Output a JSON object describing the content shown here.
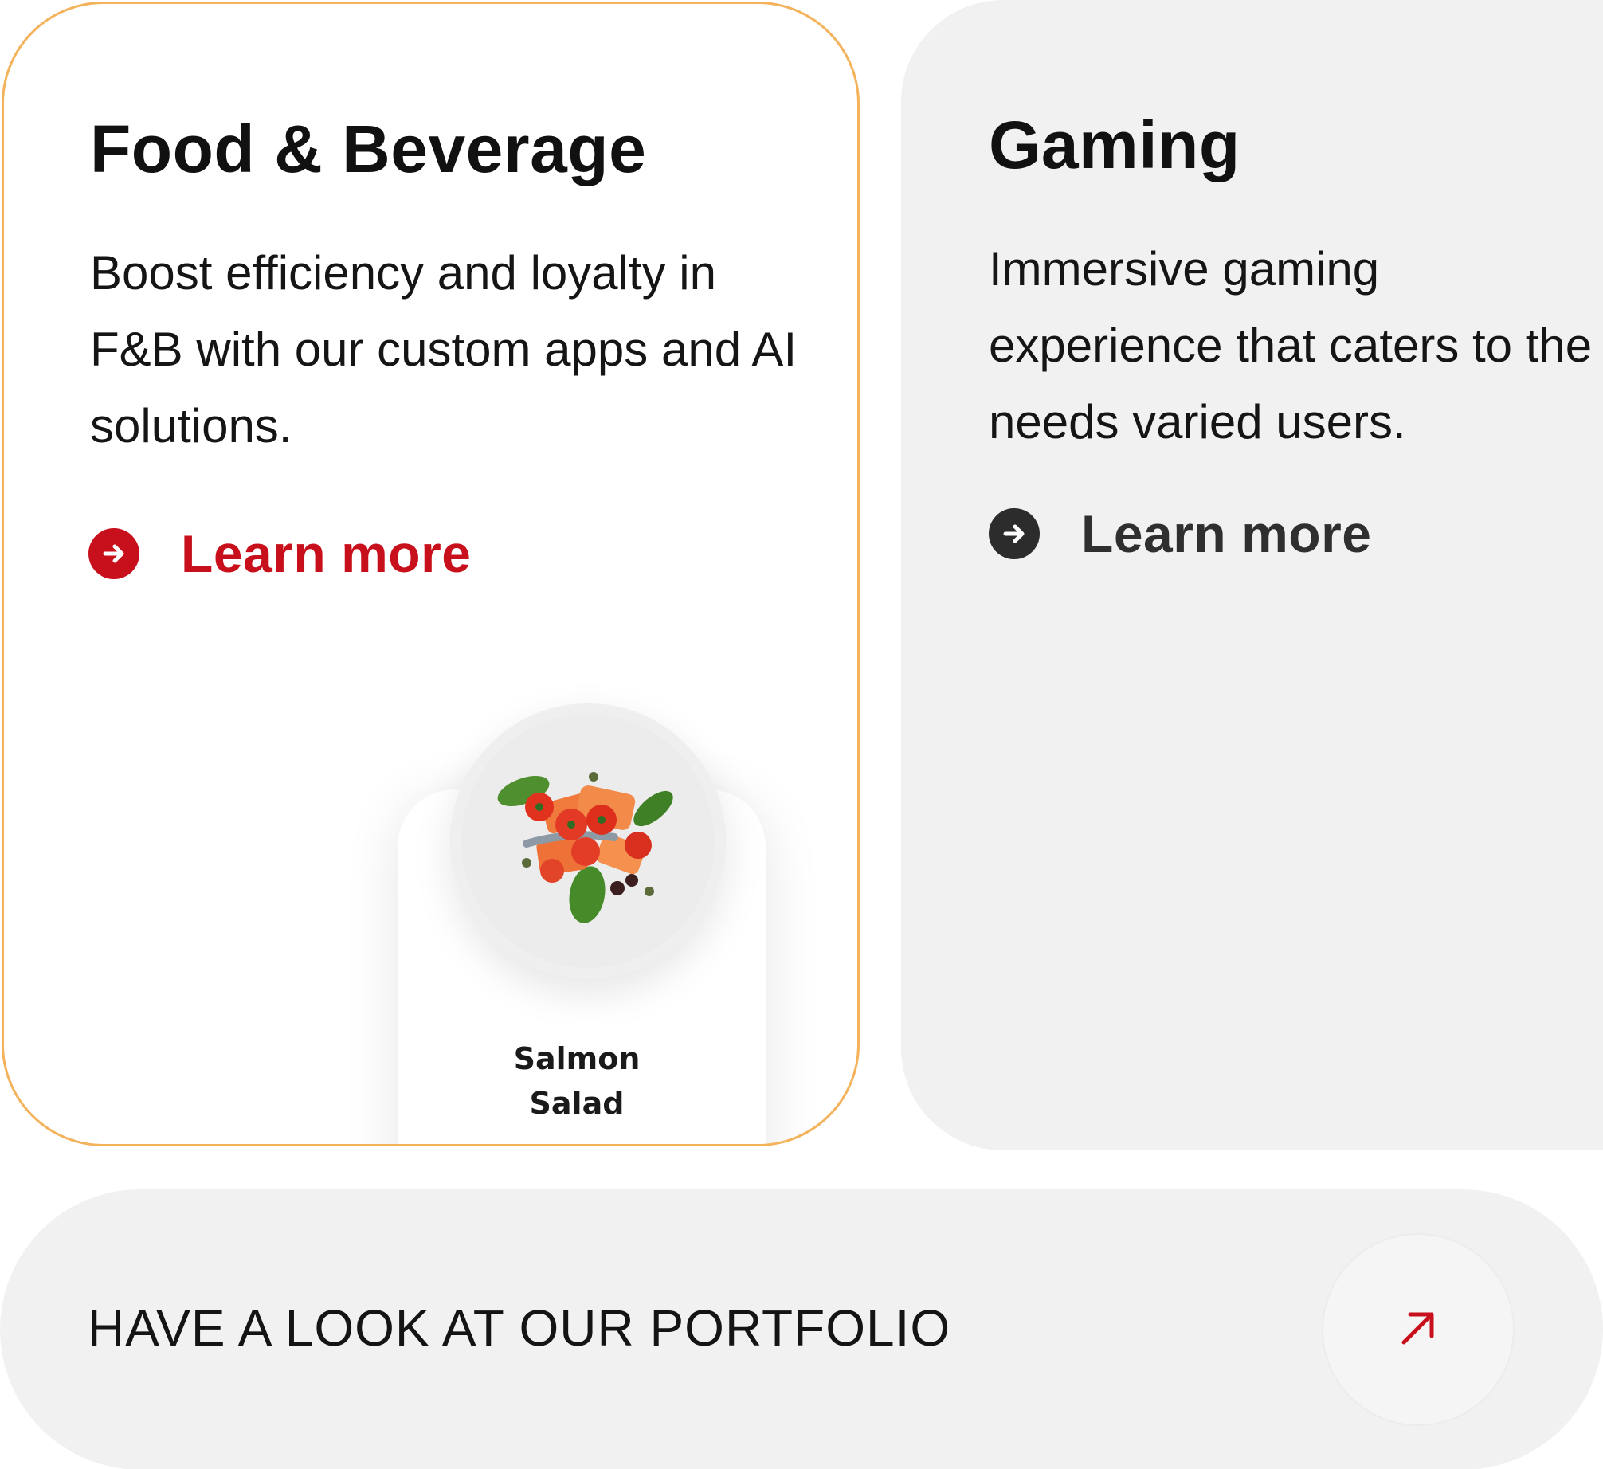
{
  "cards": [
    {
      "title": "Food & Beverage",
      "description": "Boost efficiency and loyalty in F&B with our custom apps and AI solutions.",
      "learn_more_label": "Learn more",
      "accent_color": "#c8101d",
      "border_color": "#f4b25b",
      "icon": "arrow-right-circle-icon",
      "menu_item": {
        "name": "Salmon Salad",
        "image": "salmon-salad-plate-image"
      }
    },
    {
      "title": "Gaming",
      "description": "Immersive gaming experience that caters to the needs varied users.",
      "learn_more_label": "Learn more",
      "accent_color": "#2c2c2c",
      "icon": "arrow-right-circle-icon"
    }
  ],
  "portfolio": {
    "label": "HAVE A LOOK AT OUR PORTFOLIO",
    "icon": "arrow-up-right-icon",
    "icon_color": "#c8101d"
  }
}
